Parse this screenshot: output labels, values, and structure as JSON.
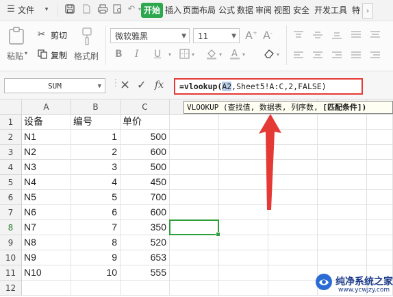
{
  "menubar": {
    "file_label": "文件",
    "tabs": [
      "开始",
      "插入",
      "页面布局",
      "公式",
      "数据",
      "审阅",
      "视图",
      "安全",
      "开发工具",
      "特"
    ],
    "more": "›"
  },
  "ribbon": {
    "paste": "粘贴",
    "cut": "剪切",
    "copy": "复制",
    "format_painter": "格式刷",
    "font_name": "微软雅黑",
    "font_size": "11",
    "bold": "B",
    "italic": "I",
    "underline": "U"
  },
  "formula_bar": {
    "name_box": "SUM",
    "fx": "fx",
    "cancel": "×",
    "confirm": "✓",
    "formula_fn": "=vlookup(",
    "formula_ref": "A2",
    "formula_rest": ",Sheet5!A:C,2,FALSE)"
  },
  "tooltip": {
    "text": "VLOOKUP (查找值, 数据表, 列序数, ",
    "bold": "[匹配条件])"
  },
  "columns": [
    "A",
    "B",
    "C"
  ],
  "rows": [
    {
      "n": "1",
      "a": "设备",
      "b": "编号",
      "c": "单价"
    },
    {
      "n": "2",
      "a": "N1",
      "b": "1",
      "c": "500"
    },
    {
      "n": "3",
      "a": "N2",
      "b": "2",
      "c": "600"
    },
    {
      "n": "4",
      "a": "N3",
      "b": "3",
      "c": "500"
    },
    {
      "n": "5",
      "a": "N4",
      "b": "4",
      "c": "450"
    },
    {
      "n": "6",
      "a": "N5",
      "b": "5",
      "c": "700"
    },
    {
      "n": "7",
      "a": "N6",
      "b": "6",
      "c": "600"
    },
    {
      "n": "8",
      "a": "N7",
      "b": "7",
      "c": "350"
    },
    {
      "n": "9",
      "a": "N8",
      "b": "8",
      "c": "520"
    },
    {
      "n": "10",
      "a": "N9",
      "b": "9",
      "c": "653"
    },
    {
      "n": "11",
      "a": "N10",
      "b": "10",
      "c": "555"
    },
    {
      "n": "12",
      "a": "",
      "b": "",
      "c": ""
    }
  ],
  "watermark": {
    "title": "纯净系统之家",
    "url": "www.ycwjzy.com"
  },
  "colors": {
    "accent": "#2da84f",
    "highlight": "#e53935",
    "selection": "#2e9e3a"
  }
}
